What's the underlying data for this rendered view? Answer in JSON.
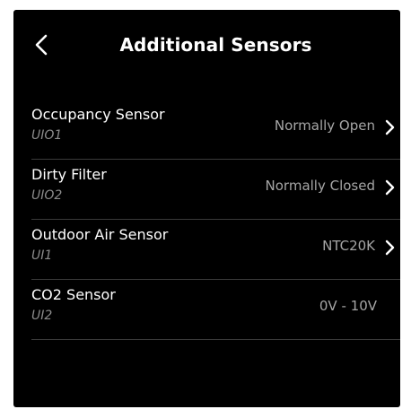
{
  "header": {
    "title": "Additional Sensors",
    "back_icon": "chevron-left-icon"
  },
  "sensors": [
    {
      "name": "Occupancy Sensor",
      "port": "UIO1",
      "value": "Normally Open",
      "has_chevron": true
    },
    {
      "name": "Dirty Filter",
      "port": "UIO2",
      "value": "Normally Closed",
      "has_chevron": true
    },
    {
      "name": "Outdoor Air Sensor",
      "port": "UI1",
      "value": "NTC20K",
      "has_chevron": true
    },
    {
      "name": "CO2 Sensor",
      "port": "UI2",
      "value": "0V - 10V",
      "has_chevron": false
    }
  ],
  "colors": {
    "background": "#000000",
    "text_primary": "#ffffff",
    "text_secondary": "#8c8c8c",
    "value_text": "#a6a6a6",
    "divider": "#3a3a3a"
  }
}
